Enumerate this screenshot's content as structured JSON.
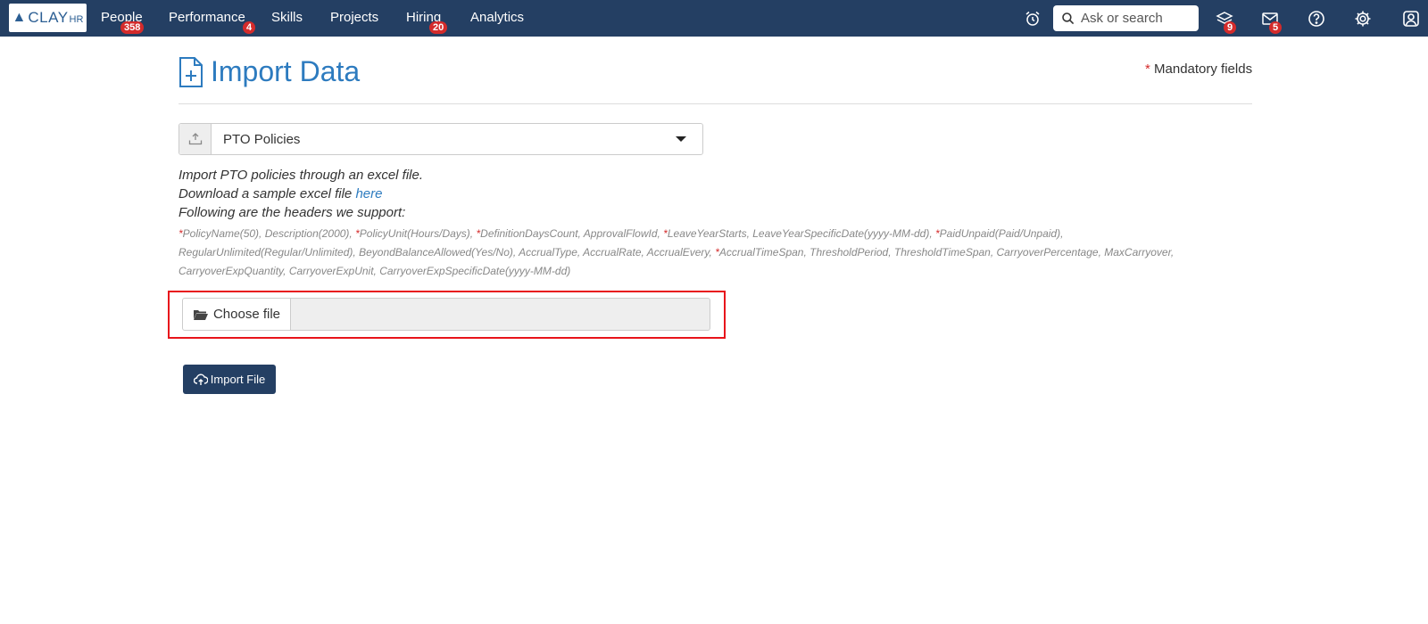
{
  "app": {
    "logo": {
      "clay": "CLAY",
      "hr": "HR"
    },
    "nav": [
      {
        "label": "People",
        "badge": "358"
      },
      {
        "label": "Performance",
        "badge": "4"
      },
      {
        "label": "Skills"
      },
      {
        "label": "Projects"
      },
      {
        "label": "Hiring",
        "badge": "20"
      },
      {
        "label": "Analytics"
      }
    ],
    "search": {
      "placeholder": "Ask or search"
    },
    "icons": {
      "layers_badge": "9",
      "mail_badge": "5"
    }
  },
  "page": {
    "title": "Import Data",
    "mandatory_star": "*",
    "mandatory_label": "Mandatory fields",
    "select_value": "PTO Policies",
    "desc_line1": "Import PTO policies through an excel file.",
    "desc_line2_prefix": "Download a sample excel file",
    "desc_line2_link": "here",
    "desc_line3": "Following are the headers we support:",
    "headers": [
      {
        "req": true,
        "text": "PolicyName(50),"
      },
      {
        "req": false,
        "text": "Description(2000),"
      },
      {
        "req": true,
        "text": "PolicyUnit(Hours/Days),"
      },
      {
        "req": true,
        "text": "DefinitionDaysCount,"
      },
      {
        "req": false,
        "text": "ApprovalFlowId,"
      },
      {
        "req": true,
        "text": "LeaveYearStarts,"
      },
      {
        "req": false,
        "text": "LeaveYearSpecificDate(yyyy-MM-dd),"
      },
      {
        "req": true,
        "text": "PaidUnpaid(Paid/Unpaid),"
      },
      {
        "req": false,
        "text": "RegularUnlimited(Regular/Unlimited),"
      },
      {
        "req": false,
        "text": "BeyondBalanceAllowed(Yes/No),"
      },
      {
        "req": false,
        "text": "AccrualType,"
      },
      {
        "req": false,
        "text": "AccrualRate,"
      },
      {
        "req": false,
        "text": "AccrualEvery,"
      },
      {
        "req": true,
        "text": "AccrualTimeSpan,"
      },
      {
        "req": false,
        "text": "ThresholdPeriod,"
      },
      {
        "req": false,
        "text": "ThresholdTimeSpan,"
      },
      {
        "req": false,
        "text": "CarryoverPercentage,"
      },
      {
        "req": false,
        "text": "MaxCarryover,"
      },
      {
        "req": false,
        "text": "CarryoverExpQuantity,"
      },
      {
        "req": false,
        "text": "CarryoverExpUnit,"
      },
      {
        "req": false,
        "text": "CarryoverExpSpecificDate(yyyy-MM-dd)"
      }
    ],
    "choose_file_label": "Choose file",
    "import_button_label": "Import File"
  },
  "colors": {
    "topbar": "#243f63",
    "accent": "#2d7bbf",
    "badge": "#d42b2b",
    "highlight": "#e8141b"
  }
}
